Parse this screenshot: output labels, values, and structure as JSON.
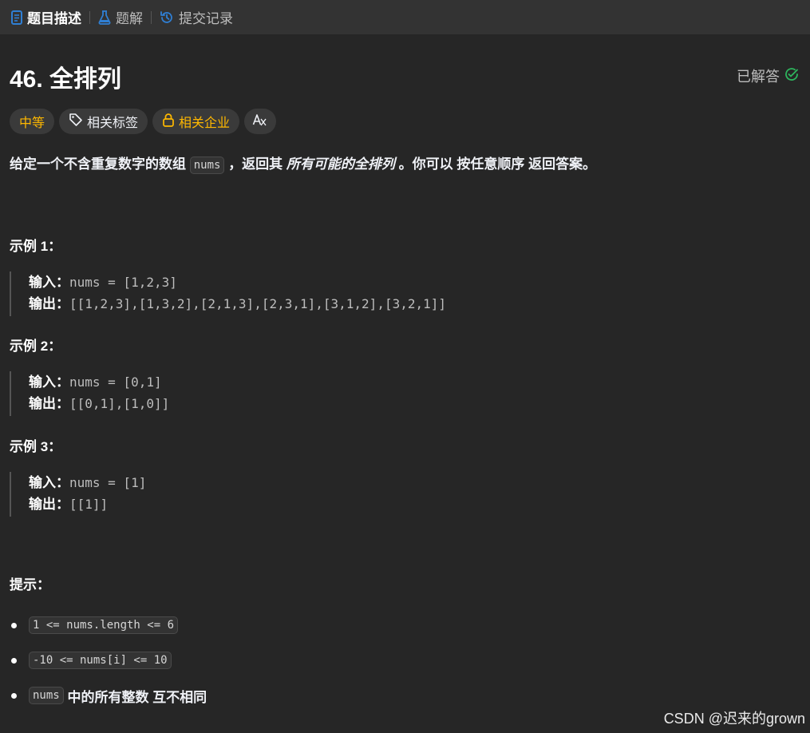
{
  "tabs": [
    {
      "label": "题目描述",
      "icon": "document-icon",
      "active": true
    },
    {
      "label": "题解",
      "icon": "flask-icon",
      "active": false
    },
    {
      "label": "提交记录",
      "icon": "history-icon",
      "active": false
    }
  ],
  "problem": {
    "title": "46. 全排列",
    "status": "已解答",
    "difficulty": "中等",
    "tags_label": "相关标签",
    "company_label": "相关企业",
    "translate_icon": "translate-icon"
  },
  "description": {
    "p1": "给定一个不含重复数字的数组",
    "code": "nums",
    "p2": "，返回其",
    "em": "所有可能的全排列",
    "p3": "。你可以",
    "strong": "按任意顺序",
    "p4": "返回答案。"
  },
  "examples": [
    {
      "title": "示例 1：",
      "input_label": "输入：",
      "input": "nums = [1,2,3]",
      "output_label": "输出：",
      "output": "[[1,2,3],[1,3,2],[2,1,3],[2,3,1],[3,1,2],[3,2,1]]"
    },
    {
      "title": "示例 2：",
      "input_label": "输入：",
      "input": "nums = [0,1]",
      "output_label": "输出：",
      "output": "[[0,1],[1,0]]"
    },
    {
      "title": "示例 3：",
      "input_label": "输入：",
      "input": "nums = [1]",
      "output_label": "输出：",
      "output": "[[1]]"
    }
  ],
  "hints": {
    "title": "提示：",
    "items": [
      {
        "code": "1 <= nums.length <= 6"
      },
      {
        "code": "-10 <= nums[i] <= 10"
      },
      {
        "code": "nums",
        "text": "中的所有整数",
        "strong": "互不相同"
      }
    ]
  },
  "watermark": "CSDN @迟来的grown",
  "colors": {
    "background": "#262626",
    "tabbar": "#333333",
    "difficulty": "#ffb800",
    "solved_check": "#2db55d",
    "accent_blue": "#2f7fd4"
  }
}
